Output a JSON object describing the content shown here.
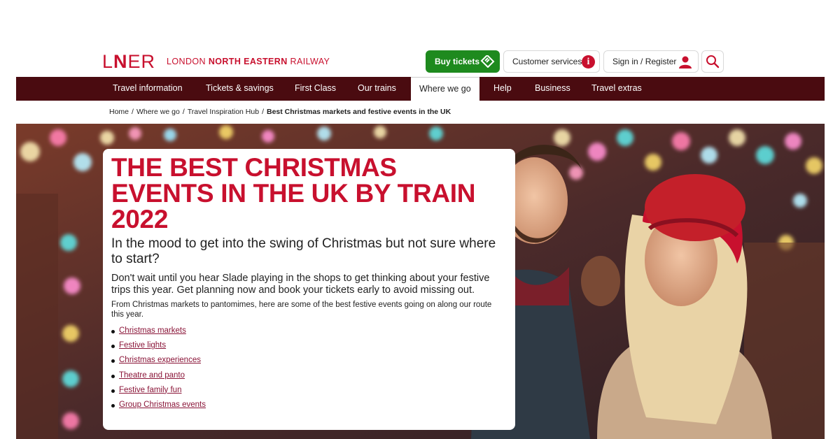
{
  "brand": {
    "logo_mark_prefix": "L",
    "logo_mark_n": "N",
    "logo_mark_suffix": "ER",
    "name_prefix": "LONDON ",
    "name_bold": "NORTH EASTERN",
    "name_suffix": " RAILWAY",
    "accent_color": "#c8102e",
    "nav_color": "#4a0b10",
    "buy_color": "#1e8a1e"
  },
  "header": {
    "buy_tickets": "Buy tickets",
    "customer_services": "Customer services",
    "sign_in": "Sign in / Register",
    "icons": [
      "ticket-icon",
      "info-icon",
      "user-icon",
      "search-icon"
    ]
  },
  "nav": {
    "items": [
      {
        "label": "Travel information"
      },
      {
        "label": "Tickets & savings"
      },
      {
        "label": "First Class"
      },
      {
        "label": "Our trains"
      },
      {
        "label": "Where we go",
        "active": true
      },
      {
        "label": "Help"
      },
      {
        "label": "Business"
      },
      {
        "label": "Travel extras"
      }
    ]
  },
  "breadcrumb": {
    "items": [
      "Home",
      "Where we go",
      "Travel Inspiration Hub"
    ],
    "current": "Best Christmas markets and festive events in the UK",
    "separator": "/"
  },
  "hero": {
    "title": "THE BEST CHRISTMAS EVENTS IN THE UK BY TRAIN 2022",
    "lead": "In the mood to get into the swing of Christmas but not sure where to start?",
    "para1": "Don't wait until you hear Slade playing in the shops to get thinking about your festive trips this year. Get planning now and book your tickets early to avoid missing out.",
    "para2": "From Christmas markets to pantomimes, here are some of the best festive events going on along our route this year.",
    "links": [
      "Christmas markets",
      "Festive lights",
      "Christmas experiences",
      "Theatre and panto",
      "Festive family fun",
      "Group Christmas events"
    ]
  }
}
